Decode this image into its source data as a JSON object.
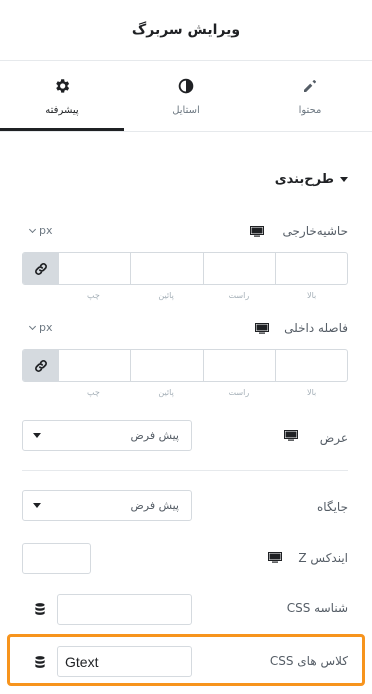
{
  "header": {
    "title": "ویرایش سربرگ"
  },
  "tabs": [
    {
      "label": "پیشرفته",
      "icon": "gear-icon",
      "active": true
    },
    {
      "label": "استایل",
      "icon": "half-circle-icon",
      "active": false
    },
    {
      "label": "محتوا",
      "icon": "pencil-icon",
      "active": false
    }
  ],
  "section": {
    "title": "طرح‌بندی"
  },
  "margin": {
    "label": "حاشیه‌خارجی",
    "unit": "px",
    "labels": {
      "top": "بالا",
      "right": "راست",
      "bottom": "پائین",
      "left": "چپ"
    }
  },
  "padding": {
    "label": "فاصله داخلی",
    "unit": "px",
    "labels": {
      "top": "بالا",
      "right": "راست",
      "bottom": "پائین",
      "left": "چپ"
    }
  },
  "width": {
    "label": "عرض",
    "value": "پیش فرض"
  },
  "position": {
    "label": "جایگاه",
    "value": "پیش فرض"
  },
  "zindex": {
    "label": "ایندکس Z"
  },
  "css_id": {
    "label": "شناسه CSS",
    "value": ""
  },
  "css_classes": {
    "label": "کلاس های CSS",
    "value": "Gtext"
  },
  "colors": {
    "accent": "#f7941d",
    "text": "#555d66",
    "border": "#d5dadf"
  }
}
